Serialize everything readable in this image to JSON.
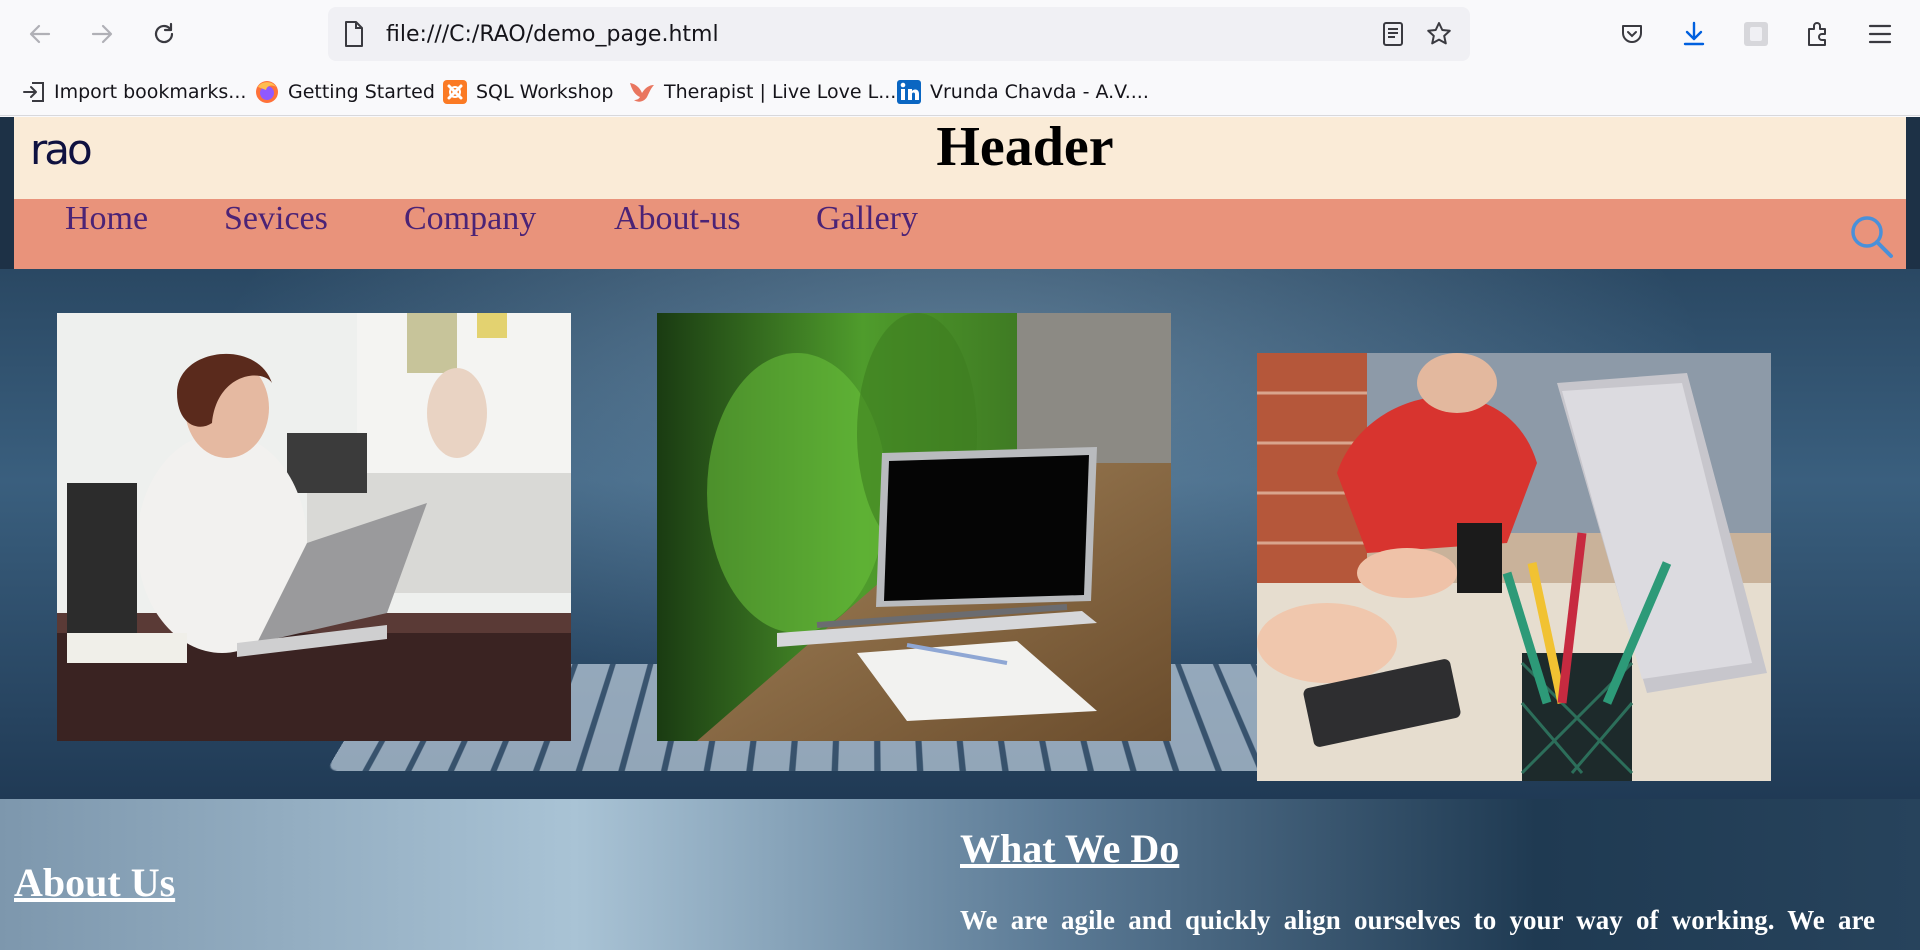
{
  "browser": {
    "url": "file:///C:/RAO/demo_page.html",
    "bookmarks": [
      {
        "label": "Import bookmarks...",
        "icon": "import-icon"
      },
      {
        "label": "Getting Started",
        "icon": "firefox-icon"
      },
      {
        "label": "SQL Workshop",
        "icon": "xampp-icon"
      },
      {
        "label": "Therapist | Live Love L...",
        "icon": "bird-icon"
      },
      {
        "label": "Vrunda Chavda - A.V....",
        "icon": "linkedin-icon"
      }
    ]
  },
  "page": {
    "logo": "rao",
    "header_title": "Header",
    "nav": [
      "Home",
      "Sevices",
      "Company",
      "About-us",
      "Gallery"
    ],
    "about_title": "About Us",
    "what_title": "What We Do",
    "what_text": "We are agile and quickly align ourselves to your way of working. We are"
  },
  "colors": {
    "header_bg": "#faebd7",
    "nav_bg": "#e9937b",
    "nav_text": "#4b2376",
    "search_icon": "#4a90d9"
  }
}
